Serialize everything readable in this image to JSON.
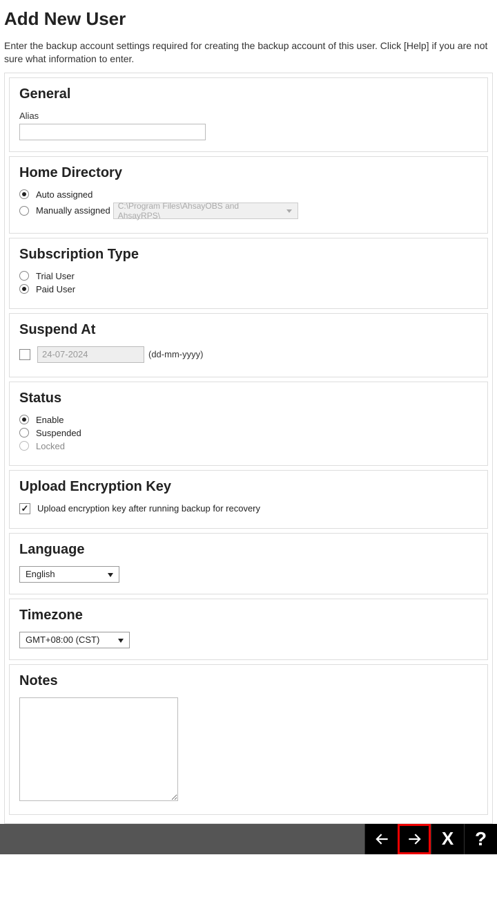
{
  "page": {
    "title": "Add New User",
    "intro": "Enter the backup account settings required for creating the backup account of this user. Click [Help] if you are not sure what information to enter."
  },
  "general": {
    "title": "General",
    "alias_label": "Alias",
    "alias_value": ""
  },
  "home_directory": {
    "title": "Home Directory",
    "auto_label": "Auto assigned",
    "manual_label": "Manually assigned",
    "manual_path": "C:\\Program Files\\AhsayOBS and AhsayRPS\\",
    "selected": "auto"
  },
  "subscription": {
    "title": "Subscription Type",
    "trial_label": "Trial User",
    "paid_label": "Paid User",
    "selected": "paid"
  },
  "suspend": {
    "title": "Suspend At",
    "date_placeholder": "24-07-2024",
    "format_hint": "(dd-mm-yyyy)",
    "checked": false
  },
  "status": {
    "title": "Status",
    "enable_label": "Enable",
    "suspended_label": "Suspended",
    "locked_label": "Locked",
    "selected": "enable"
  },
  "upload_key": {
    "title": "Upload Encryption Key",
    "checkbox_label": "Upload encryption key after running backup for recovery",
    "checked": true
  },
  "language": {
    "title": "Language",
    "selected": "English"
  },
  "timezone": {
    "title": "Timezone",
    "selected": "GMT+08:00 (CST)"
  },
  "notes": {
    "title": "Notes",
    "value": ""
  },
  "footer": {
    "back": "back",
    "next": "next",
    "cancel": "cancel",
    "help": "help"
  }
}
